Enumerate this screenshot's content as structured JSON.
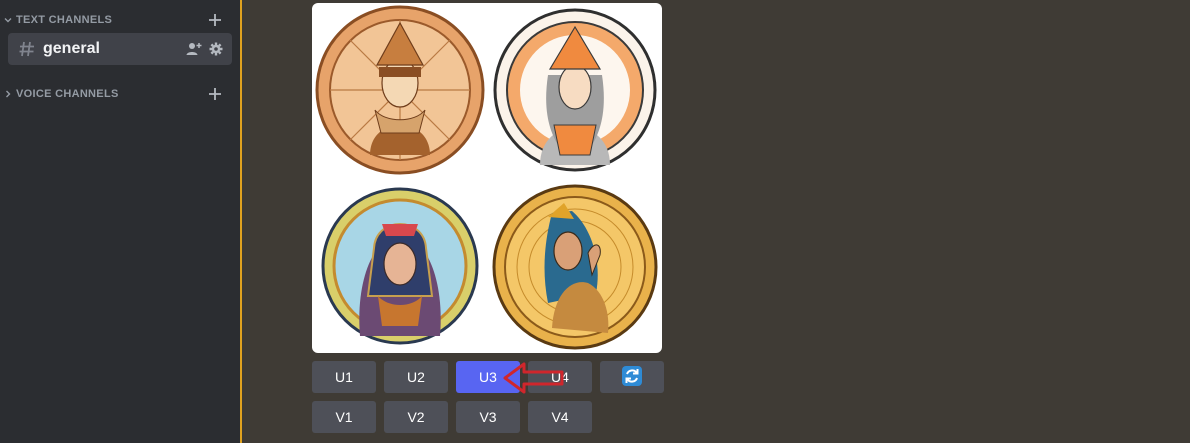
{
  "sidebar": {
    "categories": [
      {
        "label": "TEXT CHANNELS"
      },
      {
        "label": "VOICE CHANNELS"
      }
    ],
    "channels": [
      {
        "name": "general",
        "selected": true
      }
    ]
  },
  "message": {
    "image_grid": {
      "tiles": 4,
      "description_icons": [
        "medallion-portrait",
        "medallion-portrait",
        "medallion-portrait",
        "medallion-portrait"
      ]
    },
    "upscale_buttons": [
      {
        "label": "U1"
      },
      {
        "label": "U2"
      },
      {
        "label": "U3",
        "active": true
      },
      {
        "label": "U4"
      }
    ],
    "refresh_button": {
      "icon": "refresh-icon"
    },
    "variation_buttons": [
      {
        "label": "V1"
      },
      {
        "label": "V2"
      },
      {
        "label": "V3"
      },
      {
        "label": "V4"
      }
    ]
  },
  "colors": {
    "background": "#3f3b35",
    "sidebar": "#2b2d31",
    "selected_channel": "#404249",
    "button": "#4e5058",
    "button_active": "#5865f2",
    "refresh": "#2e8bd6",
    "divider": "#e0a21f",
    "annotation_arrow": "#d0262c"
  }
}
